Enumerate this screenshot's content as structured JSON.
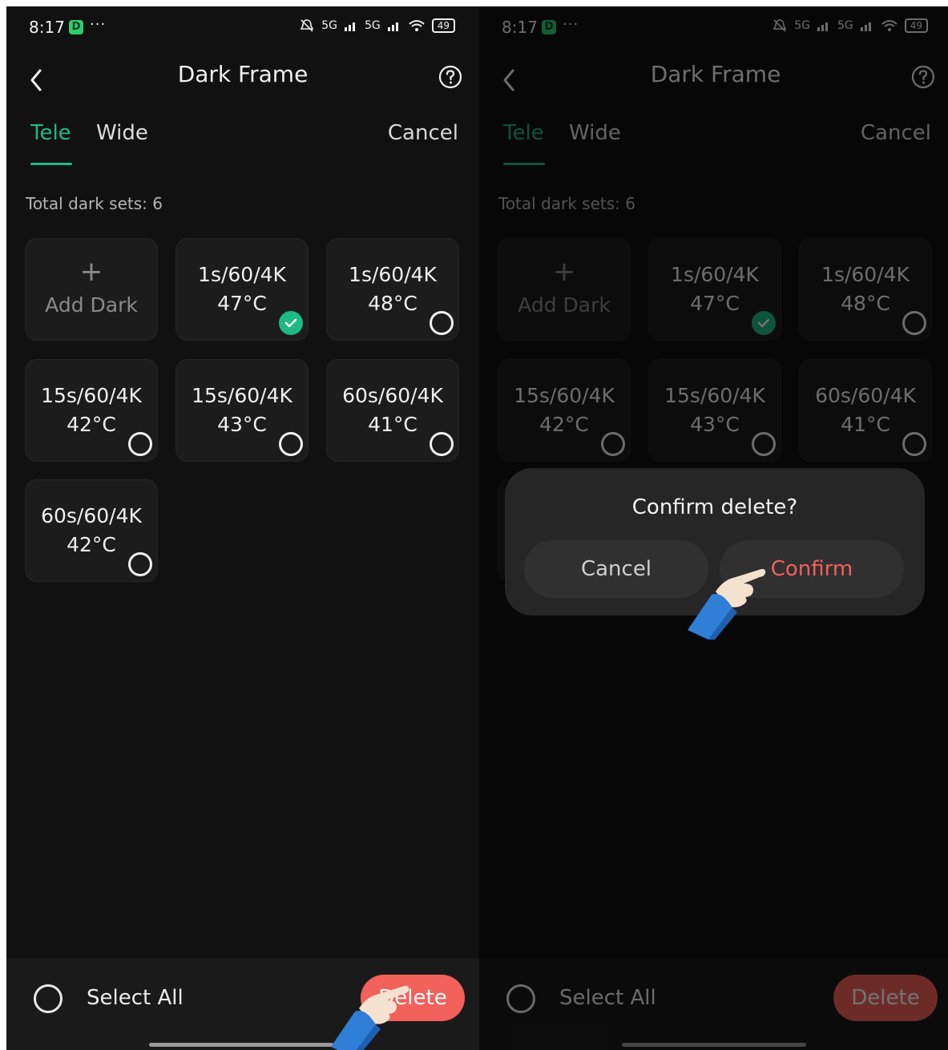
{
  "status": {
    "time": "8:17",
    "app_badge": "D",
    "dots": "···",
    "signal": "5G",
    "battery": "49"
  },
  "header": {
    "title": "Dark Frame"
  },
  "tabs": {
    "tele": "Tele",
    "wide": "Wide",
    "cancel": "Cancel"
  },
  "summary": {
    "total": "Total dark sets: 6"
  },
  "add_card": {
    "plus": "+",
    "label": "Add Dark"
  },
  "sets": [
    {
      "exposure": "1s/60/4K",
      "temp": "47°C",
      "selected": true
    },
    {
      "exposure": "1s/60/4K",
      "temp": "48°C",
      "selected": false
    },
    {
      "exposure": "15s/60/4K",
      "temp": "42°C",
      "selected": false
    },
    {
      "exposure": "15s/60/4K",
      "temp": "43°C",
      "selected": false
    },
    {
      "exposure": "60s/60/4K",
      "temp": "41°C",
      "selected": false
    },
    {
      "exposure": "60s/60/4K",
      "temp": "42°C",
      "selected": false
    }
  ],
  "bottom": {
    "select_all": "Select All",
    "delete": "Delete"
  },
  "dialog": {
    "title": "Confirm delete?",
    "cancel": "Cancel",
    "confirm": "Confirm"
  },
  "colors": {
    "accent": "#1fb985",
    "danger": "#f2615a",
    "background": "#111111"
  }
}
